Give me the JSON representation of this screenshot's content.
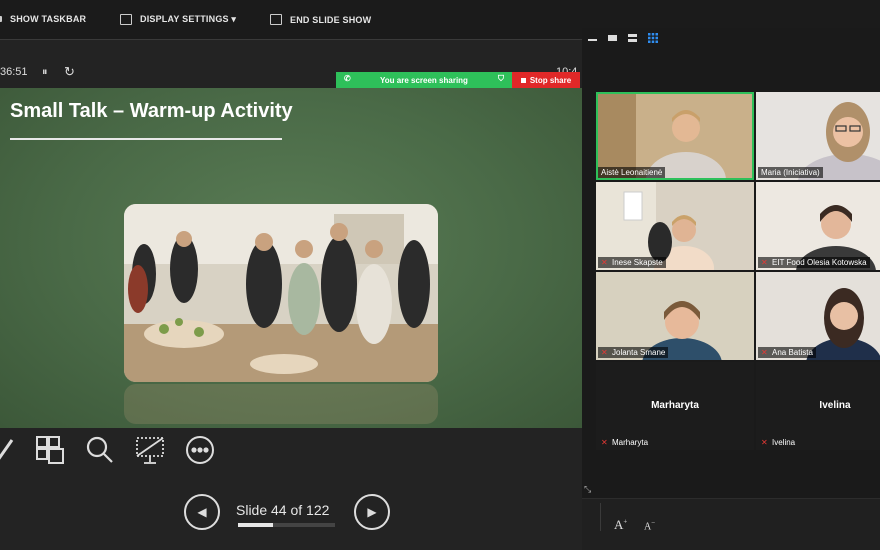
{
  "toolbar": {
    "show_taskbar": "SHOW TASKBAR",
    "display_settings": "DISPLAY SETTINGS ▾",
    "end_slide_show": "END SLIDE SHOW"
  },
  "timer": {
    "elapsed": "36:51",
    "pause": "⏸",
    "reset": "↻",
    "clock": "10:4"
  },
  "sharing": {
    "status": "You are screen sharing",
    "stop": "Stop share"
  },
  "slide": {
    "title": "Small Talk – Warm-up Activity"
  },
  "navigation": {
    "slide_counter": "Slide 44 of 122",
    "current": 44,
    "total": 122,
    "prev": "◀",
    "next": "▶"
  },
  "participants": [
    {
      "name": "Aistė Leonaitienė",
      "muted": false,
      "active": true
    },
    {
      "name": "Maria (Iniciativa)",
      "muted": false,
      "active": false
    },
    {
      "name": "Inese Skapste",
      "muted": true,
      "active": false
    },
    {
      "name": "EIT Food Olesia Kotowska",
      "muted": true,
      "active": false
    },
    {
      "name": "Jolanta Smane",
      "muted": true,
      "active": false
    },
    {
      "name": "Ana Batista",
      "muted": true,
      "active": false
    },
    {
      "name": "Marharyta",
      "muted": true,
      "active": false,
      "video": false
    },
    {
      "name": "Ivelina",
      "muted": true,
      "active": false,
      "video": false
    }
  ],
  "font_controls": {
    "increase": "A",
    "decrease": "A"
  },
  "colors": {
    "share_green": "#2ec05a",
    "stop_red": "#e02828",
    "slide_green": "#4a6a47"
  }
}
